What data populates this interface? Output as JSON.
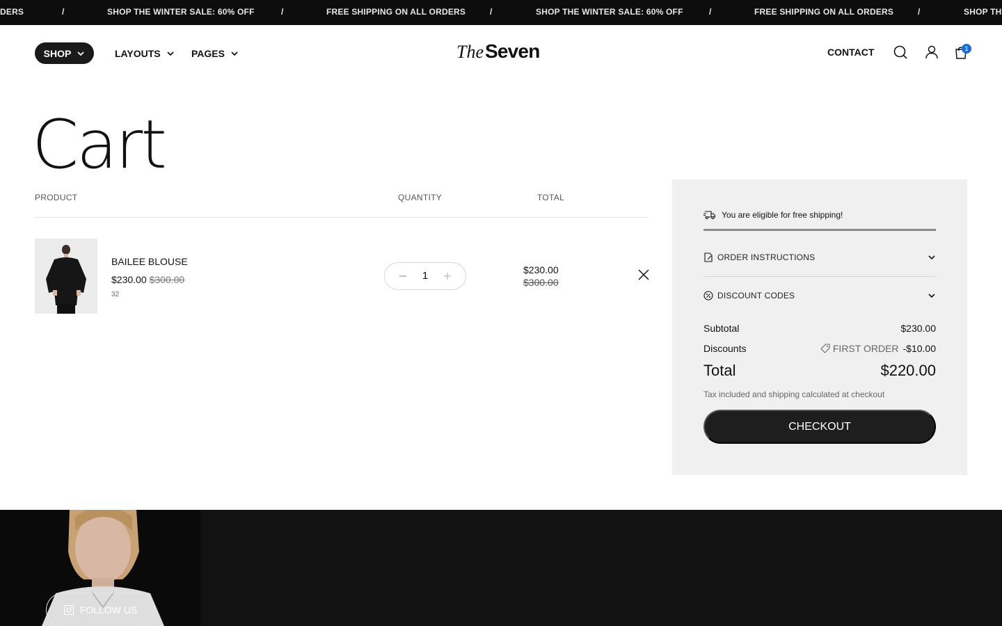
{
  "announcement": {
    "items": [
      "DERS",
      "/",
      "SHOP THE WINTER SALE: 60% OFF",
      "/",
      "FREE SHIPPING ON ALL ORDERS",
      "/",
      "SHOP THE WINTER SALE: 60% OFF",
      "/",
      "FREE SHIPPING ON ALL ORDERS",
      "/",
      "SHOP THE"
    ]
  },
  "header": {
    "nav": [
      {
        "label": "SHOP",
        "icon": "chevron-down-icon"
      },
      {
        "label": "LAYOUTS",
        "icon": "chevron-down-icon"
      },
      {
        "label": "PAGES",
        "icon": "chevron-down-icon"
      }
    ],
    "logo": {
      "the": "The",
      "seven": "Seven"
    },
    "contact_label": "CONTACT",
    "icons": [
      "search-icon",
      "account-icon",
      "cart-icon"
    ],
    "cart_count": "1"
  },
  "page": {
    "title": "Cart"
  },
  "table": {
    "headers": {
      "product": "PRODUCT",
      "quantity": "QUANTITY",
      "total": "TOTAL"
    },
    "items": [
      {
        "name": "BAILEE BLOUSE",
        "price": "$230.00",
        "compare_price": "$300.00",
        "variant": "32",
        "quantity": "1",
        "line_total": "$230.00",
        "line_compare": "$300.00"
      }
    ]
  },
  "summary": {
    "shipping_message": "You are eligible for free shipping!",
    "shipping_progress": 1.0,
    "order_instructions": "ORDER INSTRUCTIONS",
    "discount_codes": "DISCOUNT CODES",
    "subtotal_label": "Subtotal",
    "subtotal_value": "$230.00",
    "discounts_label": "Discounts",
    "discount_code": "FIRST ORDER",
    "discount_value": "-$10.00",
    "total_label": "Total",
    "total_value": "$220.00",
    "tax_note": "Tax included and shipping calculated at checkout",
    "checkout_label": "CHECKOUT"
  },
  "footer": {
    "follow_label": "FOLLOW US"
  },
  "colors": {
    "dark": "#1a1a1a",
    "panel": "#f0f0f0",
    "badge": "#1d6fd8"
  }
}
